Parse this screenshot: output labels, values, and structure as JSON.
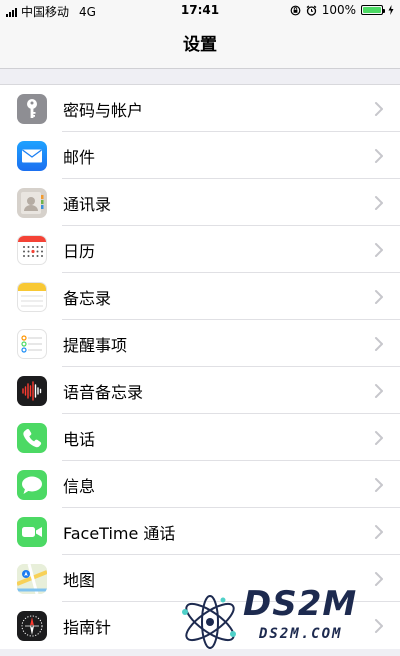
{
  "status_bar": {
    "carrier": "中国移动",
    "network": "4G",
    "time": "17:41",
    "battery_percent": "100%"
  },
  "nav": {
    "title": "设置"
  },
  "rows": [
    {
      "label": "密码与帐户",
      "icon": "key-icon",
      "color": "#8e8e93"
    },
    {
      "label": "邮件",
      "icon": "mail-icon",
      "color": "#1e8ef6"
    },
    {
      "label": "通讯录",
      "icon": "contacts-icon",
      "color": "#c8c3be"
    },
    {
      "label": "日历",
      "icon": "calendar-icon",
      "color": "#ffffff"
    },
    {
      "label": "备忘录",
      "icon": "notes-icon",
      "color": "#ffffff"
    },
    {
      "label": "提醒事项",
      "icon": "reminders-icon",
      "color": "#ffffff"
    },
    {
      "label": "语音备忘录",
      "icon": "voice-memos-icon",
      "color": "#1c1c1e"
    },
    {
      "label": "电话",
      "icon": "phone-icon",
      "color": "#4cd964"
    },
    {
      "label": "信息",
      "icon": "messages-icon",
      "color": "#4cd964"
    },
    {
      "label": "FaceTime 通话",
      "icon": "facetime-icon",
      "color": "#4cd964"
    },
    {
      "label": "地图",
      "icon": "maps-icon",
      "color": "#e6f0d8"
    },
    {
      "label": "指南针",
      "icon": "compass-icon",
      "color": "#1c1c1e"
    }
  ],
  "watermark": {
    "line1": "DS2M",
    "line2": "DS2M.COM"
  }
}
